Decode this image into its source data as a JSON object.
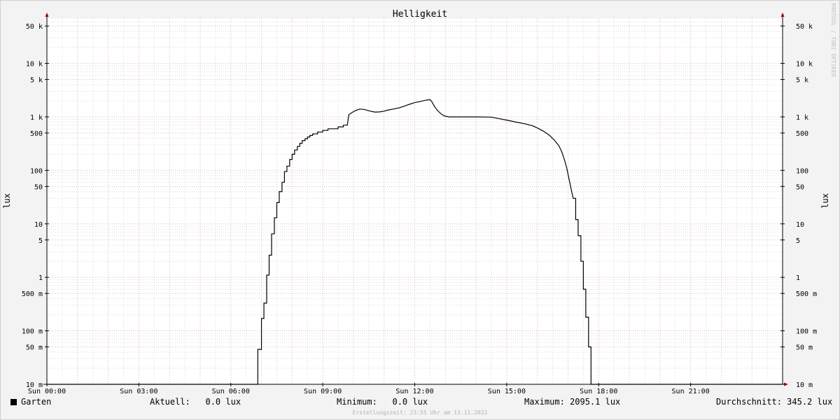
{
  "chart_data": {
    "type": "line",
    "title": "Helligkeit",
    "ylabel": "lux",
    "yscale": "log",
    "ylim": [
      0.01,
      70000
    ],
    "xlim": [
      0,
      24
    ],
    "x_tick_labels": [
      "Sun 00:00",
      "Sun 03:00",
      "Sun 06:00",
      "Sun 09:00",
      "Sun 12:00",
      "Sun 15:00",
      "Sun 18:00",
      "Sun 21:00"
    ],
    "x_tick_hours": [
      0,
      3,
      6,
      9,
      12,
      15,
      18,
      21
    ],
    "y_ticks": [
      {
        "value": 0.01,
        "label": "10 m"
      },
      {
        "value": 0.05,
        "label": "50 m"
      },
      {
        "value": 0.1,
        "label": "100 m"
      },
      {
        "value": 0.5,
        "label": "500 m"
      },
      {
        "value": 1,
        "label": "1"
      },
      {
        "value": 5,
        "label": "5"
      },
      {
        "value": 10,
        "label": "10"
      },
      {
        "value": 50,
        "label": "50"
      },
      {
        "value": 100,
        "label": "100"
      },
      {
        "value": 500,
        "label": "500"
      },
      {
        "value": 1000,
        "label": "1 k"
      },
      {
        "value": 5000,
        "label": "5 k"
      },
      {
        "value": 10000,
        "label": "10 k"
      },
      {
        "value": 50000,
        "label": "50 k"
      }
    ],
    "series": [
      {
        "name": "Garten",
        "color": "#000000",
        "points": [
          [
            0.0,
            0.01
          ],
          [
            6.88,
            0.01
          ],
          [
            6.88,
            0.045
          ],
          [
            7.0,
            0.045
          ],
          [
            7.0,
            0.17
          ],
          [
            7.08,
            0.17
          ],
          [
            7.08,
            0.33
          ],
          [
            7.17,
            0.33
          ],
          [
            7.17,
            1.1
          ],
          [
            7.25,
            1.1
          ],
          [
            7.25,
            2.6
          ],
          [
            7.33,
            2.6
          ],
          [
            7.33,
            6.5
          ],
          [
            7.42,
            6.5
          ],
          [
            7.42,
            13
          ],
          [
            7.5,
            13
          ],
          [
            7.5,
            25
          ],
          [
            7.58,
            25
          ],
          [
            7.58,
            40
          ],
          [
            7.67,
            40
          ],
          [
            7.67,
            60
          ],
          [
            7.75,
            60
          ],
          [
            7.75,
            95
          ],
          [
            7.83,
            95
          ],
          [
            7.83,
            120
          ],
          [
            7.92,
            120
          ],
          [
            7.92,
            160
          ],
          [
            8.0,
            160
          ],
          [
            8.0,
            200
          ],
          [
            8.08,
            200
          ],
          [
            8.08,
            240
          ],
          [
            8.17,
            240
          ],
          [
            8.17,
            280
          ],
          [
            8.25,
            280
          ],
          [
            8.25,
            320
          ],
          [
            8.33,
            320
          ],
          [
            8.33,
            360
          ],
          [
            8.42,
            360
          ],
          [
            8.42,
            390
          ],
          [
            8.5,
            390
          ],
          [
            8.5,
            420
          ],
          [
            8.58,
            420
          ],
          [
            8.58,
            450
          ],
          [
            8.67,
            450
          ],
          [
            8.67,
            480
          ],
          [
            8.83,
            480
          ],
          [
            8.83,
            520
          ],
          [
            9.0,
            520
          ],
          [
            9.0,
            560
          ],
          [
            9.17,
            560
          ],
          [
            9.17,
            600
          ],
          [
            9.5,
            600
          ],
          [
            9.5,
            650
          ],
          [
            9.67,
            650
          ],
          [
            9.67,
            700
          ],
          [
            9.8,
            700
          ],
          [
            9.85,
            1100
          ],
          [
            9.95,
            1200
          ],
          [
            10.05,
            1300
          ],
          [
            10.2,
            1400
          ],
          [
            10.35,
            1380
          ],
          [
            10.55,
            1280
          ],
          [
            10.7,
            1230
          ],
          [
            10.85,
            1240
          ],
          [
            11.0,
            1280
          ],
          [
            11.1,
            1330
          ],
          [
            11.3,
            1400
          ],
          [
            11.5,
            1480
          ],
          [
            11.65,
            1580
          ],
          [
            11.8,
            1700
          ],
          [
            12.0,
            1850
          ],
          [
            12.2,
            1950
          ],
          [
            12.35,
            2050
          ],
          [
            12.5,
            2095
          ],
          [
            12.55,
            1950
          ],
          [
            12.65,
            1550
          ],
          [
            12.75,
            1300
          ],
          [
            12.85,
            1150
          ],
          [
            12.95,
            1050
          ],
          [
            13.1,
            1000
          ],
          [
            13.5,
            1000
          ],
          [
            14.0,
            1000
          ],
          [
            14.5,
            990
          ],
          [
            14.7,
            940
          ],
          [
            15.0,
            870
          ],
          [
            15.3,
            800
          ],
          [
            15.6,
            740
          ],
          [
            15.85,
            680
          ],
          [
            16.0,
            620
          ],
          [
            16.2,
            540
          ],
          [
            16.4,
            450
          ],
          [
            16.55,
            370
          ],
          [
            16.7,
            290
          ],
          [
            16.8,
            220
          ],
          [
            16.88,
            160
          ],
          [
            16.96,
            110
          ],
          [
            17.03,
            70
          ],
          [
            17.1,
            45
          ],
          [
            17.17,
            30
          ],
          [
            17.25,
            30
          ],
          [
            17.25,
            12
          ],
          [
            17.33,
            12
          ],
          [
            17.33,
            6
          ],
          [
            17.42,
            6
          ],
          [
            17.42,
            2
          ],
          [
            17.5,
            2
          ],
          [
            17.5,
            0.6
          ],
          [
            17.58,
            0.6
          ],
          [
            17.58,
            0.18
          ],
          [
            17.67,
            0.18
          ],
          [
            17.67,
            0.05
          ],
          [
            17.75,
            0.05
          ],
          [
            17.75,
            0.01
          ],
          [
            24.0,
            0.01
          ]
        ]
      }
    ]
  },
  "legend": {
    "series_label": "Garten",
    "current": "Aktuell:   0.0 lux",
    "minimum": "Minimum:   0.0 lux",
    "maximum": "Maximum: 2095.1 lux",
    "average": "Durchschnitt: 345.2 lux"
  },
  "footer": "Erstellungszeit: 23:55 Uhr am 13.11.2022",
  "watermark": "RRDTOOL / TOBI OETIKER"
}
